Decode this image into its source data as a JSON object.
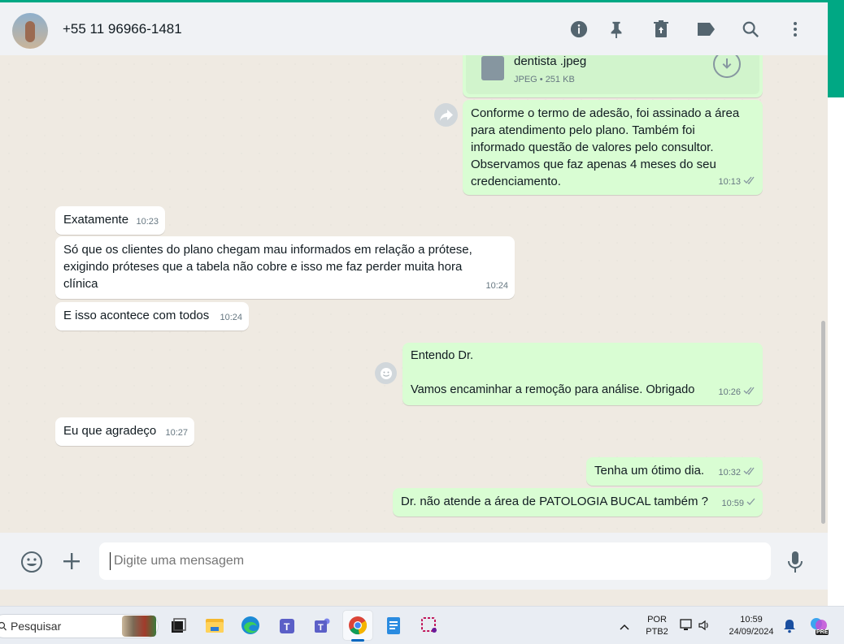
{
  "header": {
    "contact_name": "+55 11 96966-1481",
    "icons": [
      "info-icon",
      "pin-icon",
      "delete-icon",
      "label-icon",
      "search-icon",
      "menu-icon"
    ]
  },
  "attachment": {
    "filename": "dentista .jpeg",
    "meta": "JPEG • 251 KB"
  },
  "messages": [
    {
      "direction": "out",
      "text": "Conforme o termo de adesão, foi assinado a área para atendimento pelo plano. Também foi informado questão de valores pelo consultor. Observamos que faz apenas 4 meses do seu credenciamento.",
      "time": "10:13",
      "status": "read"
    },
    {
      "direction": "in",
      "text": "Exatamente",
      "time": "10:23"
    },
    {
      "direction": "in",
      "text": "Só que os clientes do plano chegam mau informados em relação a prótese, exigindo próteses que a tabela não cobre e isso me faz perder muita hora clínica",
      "time": "10:24"
    },
    {
      "direction": "in",
      "text": "E isso acontece com todos",
      "time": "10:24"
    },
    {
      "direction": "out",
      "text": "Entendo Dr.\n\nVamos encaminhar a remoção para análise. Obrigado",
      "time": "10:26",
      "status": "read"
    },
    {
      "direction": "in",
      "text": "Eu que agradeço",
      "time": "10:27"
    },
    {
      "direction": "out",
      "text": "Tenha um ótimo dia.",
      "time": "10:32",
      "status": "read"
    },
    {
      "direction": "out",
      "text": "Dr. não atende a área de PATOLOGIA BUCAL também ?",
      "time": "10:59",
      "status": "sent"
    }
  ],
  "composer": {
    "placeholder": "Digite uma mensagem"
  },
  "taskbar": {
    "search_label": "Pesquisar",
    "lang_line1": "POR",
    "lang_line2": "PTB2",
    "clock_time": "10:59",
    "clock_date": "24/09/2024",
    "copilot_badge": "PRE"
  }
}
